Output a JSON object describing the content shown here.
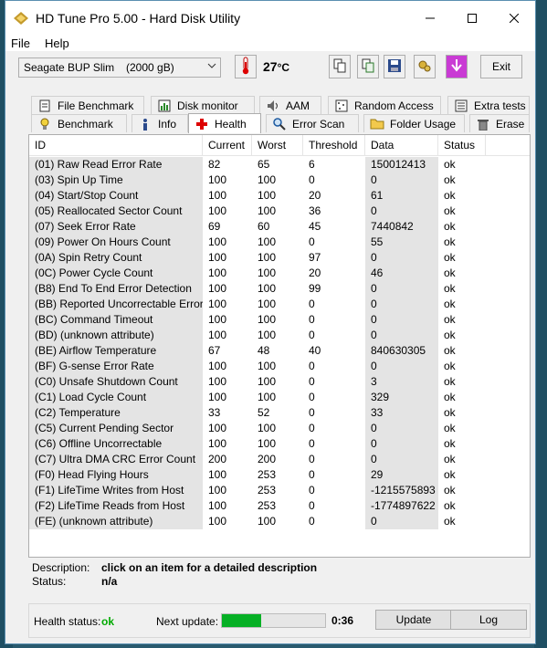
{
  "window": {
    "title": "HD Tune Pro 5.00 - Hard Disk Utility"
  },
  "menu": [
    "File",
    "Help"
  ],
  "toolbar": {
    "drive_name": "Seagate BUP Slim",
    "drive_size": "(2000 gB)",
    "temperature": "27",
    "temperature_unit": "°C",
    "exit_label": "Exit"
  },
  "tabs": {
    "row1": [
      "File Benchmark",
      "Disk monitor",
      "AAM",
      "Random Access",
      "Extra tests"
    ],
    "row2": [
      "Benchmark",
      "Info",
      "Health",
      "Error Scan",
      "Folder Usage",
      "Erase"
    ],
    "active": "Health"
  },
  "table": {
    "headers": [
      "ID",
      "Current",
      "Worst",
      "Threshold",
      "Data",
      "Status"
    ],
    "rows": [
      [
        "(01) Raw Read Error Rate",
        "82",
        "65",
        "6",
        "150012413",
        "ok"
      ],
      [
        "(03) Spin Up Time",
        "100",
        "100",
        "0",
        "0",
        "ok"
      ],
      [
        "(04) Start/Stop Count",
        "100",
        "100",
        "20",
        "61",
        "ok"
      ],
      [
        "(05) Reallocated Sector Count",
        "100",
        "100",
        "36",
        "0",
        "ok"
      ],
      [
        "(07) Seek Error Rate",
        "69",
        "60",
        "45",
        "7440842",
        "ok"
      ],
      [
        "(09) Power On Hours Count",
        "100",
        "100",
        "0",
        "55",
        "ok"
      ],
      [
        "(0A) Spin Retry Count",
        "100",
        "100",
        "97",
        "0",
        "ok"
      ],
      [
        "(0C) Power Cycle Count",
        "100",
        "100",
        "20",
        "46",
        "ok"
      ],
      [
        "(B8) End To End Error Detection",
        "100",
        "100",
        "99",
        "0",
        "ok"
      ],
      [
        "(BB) Reported Uncorrectable Errors",
        "100",
        "100",
        "0",
        "0",
        "ok"
      ],
      [
        "(BC) Command Timeout",
        "100",
        "100",
        "0",
        "0",
        "ok"
      ],
      [
        "(BD) (unknown attribute)",
        "100",
        "100",
        "0",
        "0",
        "ok"
      ],
      [
        "(BE) Airflow Temperature",
        "67",
        "48",
        "40",
        "840630305",
        "ok"
      ],
      [
        "(BF) G-sense Error Rate",
        "100",
        "100",
        "0",
        "0",
        "ok"
      ],
      [
        "(C0) Unsafe Shutdown Count",
        "100",
        "100",
        "0",
        "3",
        "ok"
      ],
      [
        "(C1) Load Cycle Count",
        "100",
        "100",
        "0",
        "329",
        "ok"
      ],
      [
        "(C2) Temperature",
        "33",
        "52",
        "0",
        "33",
        "ok"
      ],
      [
        "(C5) Current Pending Sector",
        "100",
        "100",
        "0",
        "0",
        "ok"
      ],
      [
        "(C6) Offline Uncorrectable",
        "100",
        "100",
        "0",
        "0",
        "ok"
      ],
      [
        "(C7) Ultra DMA CRC Error Count",
        "200",
        "200",
        "0",
        "0",
        "ok"
      ],
      [
        "(F0) Head Flying Hours",
        "100",
        "253",
        "0",
        "29",
        "ok"
      ],
      [
        "(F1) LifeTime Writes from Host",
        "100",
        "253",
        "0",
        "-1215575893",
        "ok"
      ],
      [
        "(F2) LifeTime Reads from Host",
        "100",
        "253",
        "0",
        "-1774897622",
        "ok"
      ],
      [
        "(FE) (unknown attribute)",
        "100",
        "100",
        "0",
        "0",
        "ok"
      ]
    ]
  },
  "details": {
    "description_label": "Description:",
    "description_value": "click on an item for a detailed description",
    "status_label": "Status:",
    "status_value": "n/a"
  },
  "footer": {
    "health_label": "Health status:",
    "health_value": "ok",
    "next_update_label": "Next update:",
    "progress_fraction": 0.38,
    "countdown": "0:36",
    "update_label": "Update",
    "log_label": "Log"
  },
  "colors": {
    "health_ok": "#00aa00",
    "progress_fill": "#06b025",
    "window_border": "#5a8fb0"
  }
}
